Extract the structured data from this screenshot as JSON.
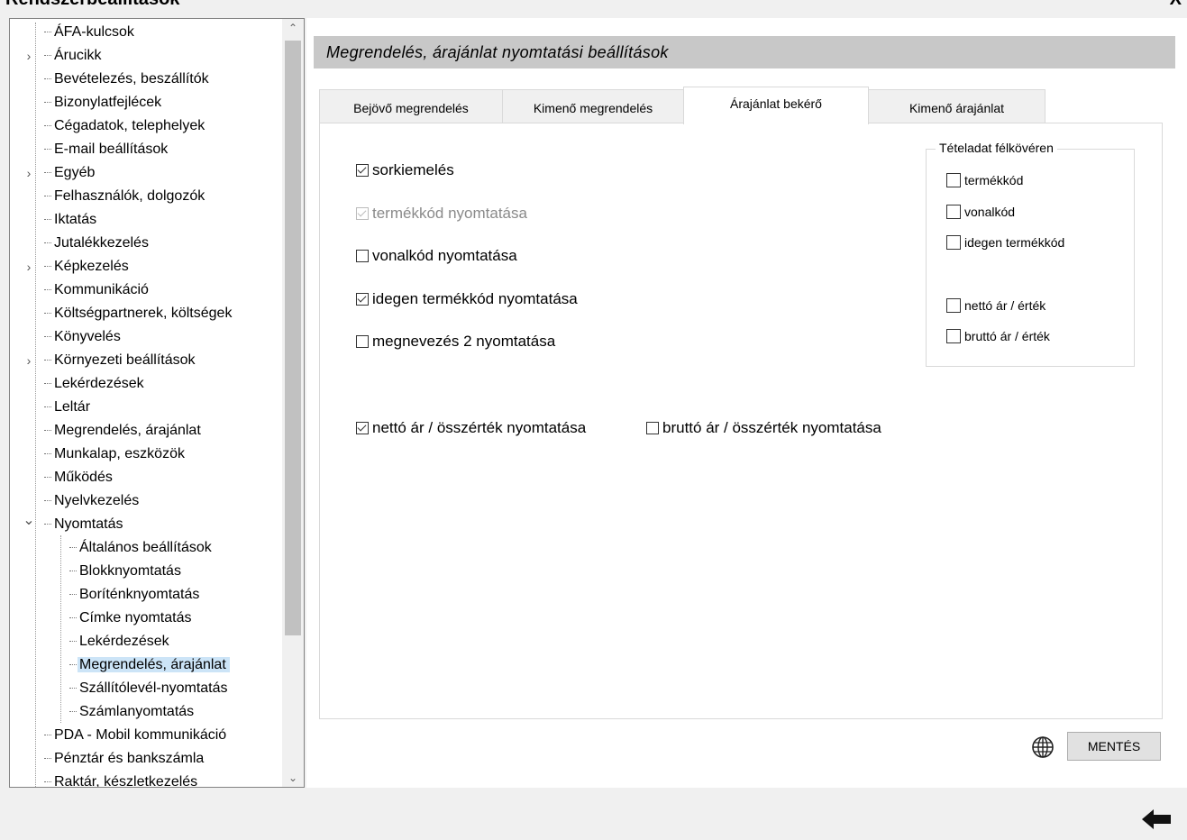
{
  "header": {
    "title_cut": "Rendszerbeállítások",
    "right_cut": "X"
  },
  "tree": {
    "items": [
      {
        "label": "ÁFA-kulcsok",
        "level": 0,
        "expandable": false
      },
      {
        "label": "Árucikk",
        "level": 0,
        "expandable": true,
        "expanded": false
      },
      {
        "label": "Bevételezés, beszállítók",
        "level": 0,
        "expandable": false
      },
      {
        "label": "Bizonylatfejlécek",
        "level": 0,
        "expandable": false
      },
      {
        "label": "Cégadatok, telephelyek",
        "level": 0,
        "expandable": false
      },
      {
        "label": "E-mail beállítások",
        "level": 0,
        "expandable": false
      },
      {
        "label": "Egyéb",
        "level": 0,
        "expandable": true,
        "expanded": false
      },
      {
        "label": "Felhasználók, dolgozók",
        "level": 0,
        "expandable": false
      },
      {
        "label": "Iktatás",
        "level": 0,
        "expandable": false
      },
      {
        "label": "Jutalékkezelés",
        "level": 0,
        "expandable": false
      },
      {
        "label": "Képkezelés",
        "level": 0,
        "expandable": true,
        "expanded": false
      },
      {
        "label": "Kommunikáció",
        "level": 0,
        "expandable": false
      },
      {
        "label": "Költségpartnerek, költségek",
        "level": 0,
        "expandable": false
      },
      {
        "label": "Könyvelés",
        "level": 0,
        "expandable": false
      },
      {
        "label": "Környezeti beállítások",
        "level": 0,
        "expandable": true,
        "expanded": false
      },
      {
        "label": "Lekérdezések",
        "level": 0,
        "expandable": false
      },
      {
        "label": "Leltár",
        "level": 0,
        "expandable": false
      },
      {
        "label": "Megrendelés, árajánlat",
        "level": 0,
        "expandable": false
      },
      {
        "label": "Munkalap, eszközök",
        "level": 0,
        "expandable": false
      },
      {
        "label": "Működés",
        "level": 0,
        "expandable": false
      },
      {
        "label": "Nyelvkezelés",
        "level": 0,
        "expandable": false
      },
      {
        "label": "Nyomtatás",
        "level": 0,
        "expandable": true,
        "expanded": true
      },
      {
        "label": "Általános beállítások",
        "level": 1
      },
      {
        "label": "Blokknyomtatás",
        "level": 1
      },
      {
        "label": "Boríténknyomtatás",
        "level": 1
      },
      {
        "label": "Címke nyomtatás",
        "level": 1
      },
      {
        "label": "Lekérdezések",
        "level": 1
      },
      {
        "label": "Megrendelés, árajánlat",
        "level": 1,
        "selected": true
      },
      {
        "label": "Szállítólevél-nyomtatás",
        "level": 1
      },
      {
        "label": "Számlanyomtatás",
        "level": 1
      },
      {
        "label": "PDA - Mobil kommunikáció",
        "level": 0,
        "expandable": false
      },
      {
        "label": "Pénztár és bankszámla",
        "level": 0,
        "expandable": false
      },
      {
        "label": "Raktár, készletkezelés",
        "level": 0,
        "expandable": false
      }
    ]
  },
  "panel": {
    "title": "Megrendelés, árajánlat nyomtatási beállítások",
    "tabs": [
      {
        "label": "Bejövő megrendelés",
        "active": false
      },
      {
        "label": "Kimenő megrendelés",
        "active": false
      },
      {
        "label": "Árajánlat bekérő",
        "active": true
      },
      {
        "label": "Kimenő árajánlat",
        "active": false
      }
    ],
    "options": [
      {
        "label": "sorkiemelés",
        "checked": true,
        "disabled": false
      },
      {
        "label": "termékkód nyomtatása",
        "checked": true,
        "disabled": true
      },
      {
        "label": "vonalkód nyomtatása",
        "checked": false,
        "disabled": false
      },
      {
        "label": "idegen termékkód nyomtatása",
        "checked": true,
        "disabled": false
      },
      {
        "label": "megnevezés 2 nyomtatása",
        "checked": false,
        "disabled": false
      }
    ],
    "price_options": [
      {
        "label": "nettó ár / összérték nyomtatása",
        "checked": true
      },
      {
        "label": "bruttó ár / összérték nyomtatása",
        "checked": false
      }
    ],
    "bold_group": {
      "legend": "Tételadat félkövéren",
      "items": [
        {
          "label": "termékkód",
          "checked": false
        },
        {
          "label": "vonalkód",
          "checked": false
        },
        {
          "label": "idegen termékkód",
          "checked": false
        },
        {
          "label": "nettó ár / érték",
          "checked": false
        },
        {
          "label": "bruttó ár / érték",
          "checked": false
        }
      ]
    },
    "save_label": "MENTÉS"
  },
  "icons": {
    "globe": "globe-icon",
    "back": "back-arrow-icon",
    "scroll_up": "chevron-up-icon",
    "scroll_down": "chevron-down-icon"
  }
}
